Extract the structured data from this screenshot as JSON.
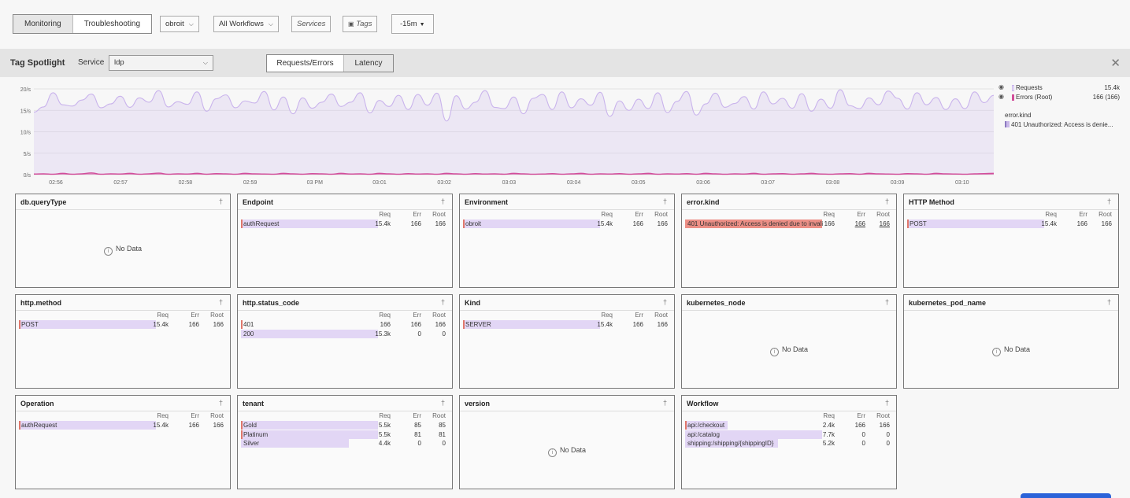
{
  "topbar": {
    "tabs": [
      "Monitoring",
      "Troubleshooting"
    ],
    "environment": "obroit",
    "workflows": "All Workflows",
    "services": "Services",
    "tags": "Tags",
    "time": "-15m"
  },
  "spotlight": {
    "title": "Tag Spotlight",
    "service_label": "Service",
    "service_value": "ldp",
    "views": [
      "Requests/Errors",
      "Latency"
    ]
  },
  "chart_data": {
    "type": "area",
    "y_ticks": [
      "20/s",
      "15/s",
      "10/s",
      "5/s",
      "0/s"
    ],
    "ylim": [
      0,
      20
    ],
    "x_ticks": [
      "02:56",
      "02:57",
      "02:58",
      "02:59",
      "03 PM",
      "03:01",
      "03:02",
      "03:03",
      "03:04",
      "03:05",
      "03:06",
      "03:07",
      "03:08",
      "03:09",
      "03:10"
    ],
    "series": [
      {
        "name": "Requests",
        "total": "15.4k",
        "color": "#c9b3ec",
        "values": [
          14.6,
          15.8,
          19.1,
          16.3,
          16.0,
          17.4,
          18.8,
          15.6,
          16.5,
          18.3,
          15.7,
          17.9,
          16.9,
          19.6,
          15.8,
          17.0,
          16.4,
          19.3,
          14.8,
          17.7,
          18.6,
          15.6,
          17.2,
          16.7,
          19.4,
          15.1,
          18.1,
          14.2,
          17.9,
          15.5,
          16.9,
          18.8,
          15.9,
          16.9,
          19.1,
          14.4,
          17.3,
          15.9,
          18.5,
          15.2,
          18.7,
          16.2,
          19.0,
          12.5,
          18.4,
          15.3,
          16.9,
          19.6,
          15.7,
          15.4,
          18.1,
          14.2,
          17.8,
          18.7,
          15.2,
          19.3,
          15.6,
          17.7,
          16.2,
          19.2,
          13.6,
          17.2,
          15.0,
          17.6,
          15.4,
          19.1,
          14.5,
          17.1,
          19.4,
          13.9,
          16.5,
          19.0,
          15.7,
          16.6,
          18.2,
          15.3,
          19.3,
          16.5,
          17.8,
          15.5,
          18.9,
          14.8,
          17.6,
          15.5,
          19.8,
          16.1,
          15.4,
          17.9,
          16.3,
          19.5,
          17.8,
          15.3,
          19.1,
          16.3,
          18.0,
          15.2,
          17.7,
          15.4,
          19.3,
          16.8,
          18.5
        ]
      },
      {
        "name": "Errors (Root)",
        "total": "166 (166)",
        "color": "#d24d9a",
        "values": [
          0.15,
          0.2,
          0.1,
          0.3,
          0.1,
          0.2,
          0.4,
          0.1,
          0.2,
          0.15,
          0.3,
          0.1,
          0.2,
          0.35,
          0.1,
          0.2,
          0.15,
          0.3,
          0.1,
          0.25,
          0.2,
          0.1,
          0.3,
          0.2,
          0.15,
          0.1,
          0.3,
          0.2,
          0.1,
          0.25,
          0.2,
          0.1,
          0.3,
          0.15,
          0.2,
          0.1,
          0.3,
          0.2,
          0.1,
          0.25,
          0.15,
          0.2,
          0.1,
          0.3,
          0.2,
          0.1,
          0.25,
          0.15,
          0.2,
          0.1,
          0.3,
          0.2,
          0.1,
          0.15,
          0.25,
          0.1,
          0.2,
          0.3,
          0.1,
          0.2,
          0.15,
          0.25,
          0.1,
          0.2,
          0.3,
          0.1,
          0.2,
          0.15,
          0.25,
          0.1,
          0.3,
          0.2,
          0.1,
          0.2,
          0.15,
          0.3,
          0.1,
          0.2,
          0.25,
          0.1,
          0.2,
          0.3,
          0.15,
          0.1,
          0.2,
          0.25,
          0.1,
          0.3,
          0.2,
          0.15,
          0.1,
          0.25,
          0.2,
          0.1,
          0.3,
          0.2,
          0.15,
          0.1,
          0.2,
          0.25,
          0.3
        ]
      }
    ],
    "extra_legend": {
      "title": "error.kind",
      "item": "401 Unauthorized: Access is denie..."
    }
  },
  "cols": {
    "req": "Req",
    "err": "Err",
    "root": "Root"
  },
  "no_data": "No Data",
  "cards": [
    {
      "title": "db.queryType",
      "rows": []
    },
    {
      "title": "Endpoint",
      "rows": [
        {
          "label": "authRequest",
          "req": "15.4k",
          "err": "166",
          "root": "166",
          "frac": 1.0,
          "mark": true
        }
      ]
    },
    {
      "title": "Environment",
      "rows": [
        {
          "label": "obroit",
          "req": "15.4k",
          "err": "166",
          "root": "166",
          "frac": 1.0,
          "mark": true
        }
      ]
    },
    {
      "title": "error.kind",
      "rows": [
        {
          "label": "401 Unauthorized: Access is denied due to invali",
          "req": "166",
          "err": "166",
          "root": "166",
          "frac": 1.0,
          "error": true,
          "underline": true
        }
      ]
    },
    {
      "title": "HTTP Method",
      "rows": [
        {
          "label": "POST",
          "req": "15.4k",
          "err": "166",
          "root": "166",
          "frac": 1.0,
          "mark": true
        }
      ]
    },
    {
      "title": "http.method",
      "rows": [
        {
          "label": "POST",
          "req": "15.4k",
          "err": "166",
          "root": "166",
          "frac": 1.0,
          "mark": true
        }
      ]
    },
    {
      "title": "http.status_code",
      "rows": [
        {
          "label": "401",
          "req": "166",
          "err": "166",
          "root": "166",
          "frac": 0.0,
          "mark": true
        },
        {
          "label": "200",
          "req": "15.3k",
          "err": "0",
          "root": "0",
          "frac": 1.0
        }
      ]
    },
    {
      "title": "Kind",
      "rows": [
        {
          "label": "SERVER",
          "req": "15.4k",
          "err": "166",
          "root": "166",
          "frac": 1.0,
          "mark": true
        }
      ]
    },
    {
      "title": "kubernetes_node",
      "rows": []
    },
    {
      "title": "kubernetes_pod_name",
      "rows": []
    },
    {
      "title": "Operation",
      "rows": [
        {
          "label": "authRequest",
          "req": "15.4k",
          "err": "166",
          "root": "166",
          "frac": 1.0,
          "mark": true
        }
      ]
    },
    {
      "title": "tenant",
      "rows": [
        {
          "label": "Gold",
          "req": "5.5k",
          "err": "85",
          "root": "85",
          "frac": 1.0,
          "mark": true
        },
        {
          "label": "Platinum",
          "req": "5.5k",
          "err": "81",
          "root": "81",
          "frac": 1.0,
          "mark": true
        },
        {
          "label": "Silver",
          "req": "4.4k",
          "err": "0",
          "root": "0",
          "frac": 0.79
        }
      ]
    },
    {
      "title": "version",
      "rows": []
    },
    {
      "title": "Workflow",
      "rows": [
        {
          "label": "api:/checkout",
          "req": "2.4k",
          "err": "166",
          "root": "166",
          "frac": 0.31,
          "mark": true
        },
        {
          "label": "api:/catalog",
          "req": "7.7k",
          "err": "0",
          "root": "0",
          "frac": 1.0
        },
        {
          "label": "shipping:/shipping/{shippingID}",
          "req": "5.2k",
          "err": "0",
          "root": "0",
          "frac": 0.68
        }
      ]
    }
  ]
}
